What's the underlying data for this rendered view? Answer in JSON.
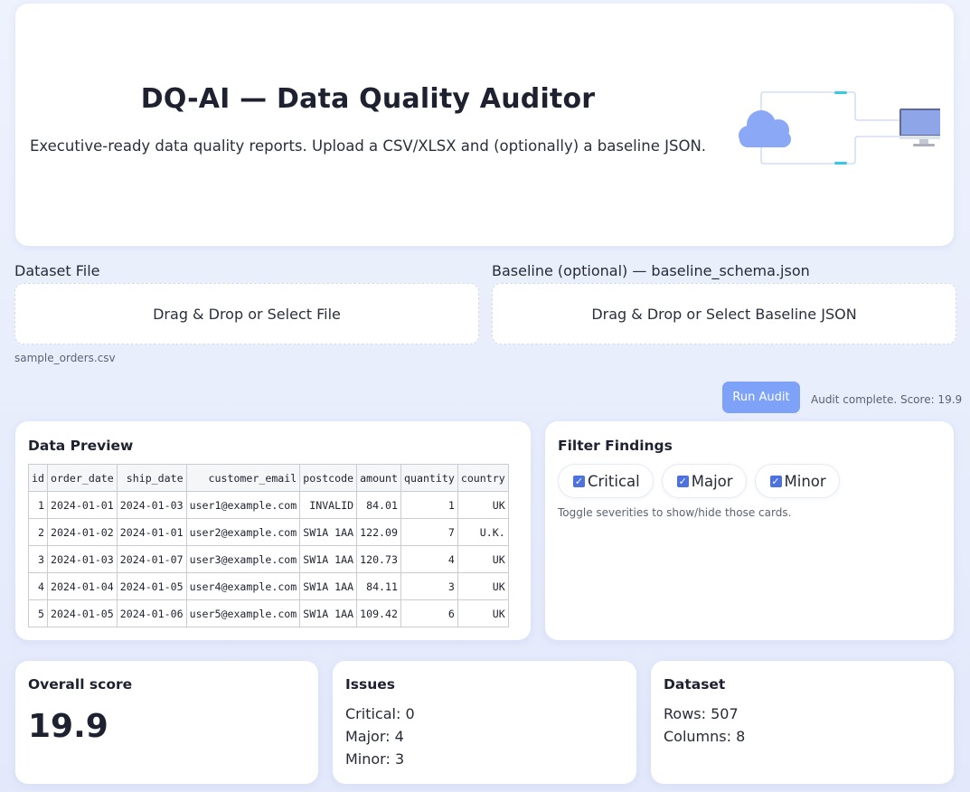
{
  "hero": {
    "title": "DQ-AI — Data Quality Auditor",
    "subtitle": "Executive-ready data quality reports. Upload a CSV/XLSX and (optionally) a baseline JSON.",
    "illustration_icons": [
      "cloud-icon",
      "monitor-icon"
    ]
  },
  "upload": {
    "dataset_label": "Dataset File",
    "dataset_drop_text": "Drag & Drop or Select File",
    "dataset_file_name": "sample_orders.csv",
    "baseline_label": "Baseline (optional) — baseline_schema.json",
    "baseline_drop_text": "Drag & Drop or Select Baseline JSON"
  },
  "actions": {
    "run_label": "Run Audit",
    "status": "Audit complete. Score: 19.9"
  },
  "preview": {
    "title": "Data Preview",
    "columns": [
      "id",
      "order_date",
      "ship_date",
      "customer_email",
      "postcode",
      "amount",
      "quantity",
      "country"
    ],
    "rows": [
      [
        "1",
        "2024-01-01",
        "2024-01-03",
        "user1@example.com",
        "INVALID",
        "84.01",
        "1",
        "UK"
      ],
      [
        "2",
        "2024-01-02",
        "2024-01-01",
        "user2@example.com",
        "SW1A 1AA",
        "122.09",
        "7",
        "U.K."
      ],
      [
        "3",
        "2024-01-03",
        "2024-01-07",
        "user3@example.com",
        "SW1A 1AA",
        "120.73",
        "4",
        "UK"
      ],
      [
        "4",
        "2024-01-04",
        "2024-01-05",
        "user4@example.com",
        "SW1A 1AA",
        "84.11",
        "3",
        "UK"
      ],
      [
        "5",
        "2024-01-05",
        "2024-01-06",
        "user5@example.com",
        "SW1A 1AA",
        "109.42",
        "6",
        "UK"
      ]
    ]
  },
  "filters": {
    "title": "Filter Findings",
    "options": [
      {
        "label": "Critical",
        "checked": true
      },
      {
        "label": "Major",
        "checked": true
      },
      {
        "label": "Minor",
        "checked": true
      }
    ],
    "hint": "Toggle severities to show/hide those cards."
  },
  "stats": {
    "score_title": "Overall score",
    "score_value": "19.9",
    "issues_title": "Issues",
    "issues_critical": "Critical: 0",
    "issues_major": "Major: 4",
    "issues_minor": "Minor: 3",
    "dataset_title": "Dataset",
    "dataset_rows": "Rows: 507",
    "dataset_columns": "Columns: 8"
  },
  "colors": {
    "accent": "#7ea2f7",
    "checkbox": "#4d72e0",
    "illustration_cloud": "#8aa8f5",
    "illustration_connector": "#35c9e8"
  }
}
